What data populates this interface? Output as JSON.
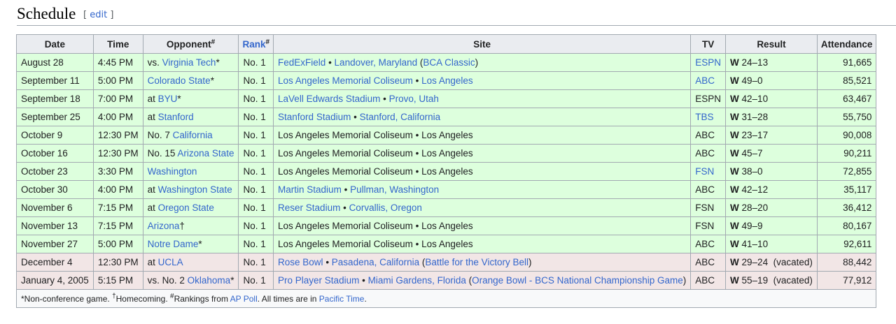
{
  "section": {
    "title": "Schedule",
    "edit_label": "edit"
  },
  "columns": {
    "date": "Date",
    "time": "Time",
    "opponent": "Opponent",
    "opponent_sup": "#",
    "rank": "Rank",
    "rank_sup": "#",
    "site": "Site",
    "tv": "TV",
    "result": "Result",
    "attendance": "Attendance"
  },
  "games": [
    {
      "status": "win",
      "date": "August 28",
      "time": "4:45 PM",
      "opp_prefix": "vs. ",
      "opp_name": "Virginia Tech",
      "opp_suffix": "*",
      "rank": "No. 1",
      "site": [
        {
          "t": "FedExField",
          "link": true
        },
        {
          "t": " • ",
          "link": false
        },
        {
          "t": "Landover, Maryland",
          "link": true
        },
        {
          "t": " (",
          "link": false
        },
        {
          "t": "BCA Classic",
          "link": true
        },
        {
          "t": ")",
          "link": false
        }
      ],
      "tv": "ESPN",
      "tv_link": true,
      "result_wl": "W",
      "result_score": " 24–13",
      "attendance": "91,665"
    },
    {
      "status": "win",
      "date": "September 11",
      "time": "5:00 PM",
      "opp_prefix": "",
      "opp_name": "Colorado State",
      "opp_suffix": "*",
      "rank": "No. 1",
      "site": [
        {
          "t": "Los Angeles Memorial Coliseum",
          "link": true
        },
        {
          "t": " • ",
          "link": false
        },
        {
          "t": "Los Angeles",
          "link": true
        }
      ],
      "tv": "ABC",
      "tv_link": true,
      "result_wl": "W",
      "result_score": " 49–0",
      "attendance": "85,521"
    },
    {
      "status": "win",
      "date": "September 18",
      "time": "7:00 PM",
      "opp_prefix": "at ",
      "opp_name": "BYU",
      "opp_suffix": "*",
      "rank": "No. 1",
      "site": [
        {
          "t": "LaVell Edwards Stadium",
          "link": true
        },
        {
          "t": " • ",
          "link": false
        },
        {
          "t": "Provo, Utah",
          "link": true
        }
      ],
      "tv": "ESPN",
      "tv_link": false,
      "result_wl": "W",
      "result_score": " 42–10",
      "attendance": "63,467"
    },
    {
      "status": "win",
      "date": "September 25",
      "time": "4:00 PM",
      "opp_prefix": "at ",
      "opp_name": "Stanford",
      "opp_suffix": "",
      "rank": "No. 1",
      "site": [
        {
          "t": "Stanford Stadium",
          "link": true
        },
        {
          "t": " • ",
          "link": false
        },
        {
          "t": "Stanford, California",
          "link": true
        }
      ],
      "tv": "TBS",
      "tv_link": true,
      "result_wl": "W",
      "result_score": " 31–28",
      "attendance": "55,750"
    },
    {
      "status": "win",
      "date": "October 9",
      "time": "12:30 PM",
      "opp_prefix": "No. 7 ",
      "opp_name": "California",
      "opp_suffix": "",
      "rank": "No. 1",
      "site": [
        {
          "t": "Los Angeles Memorial Coliseum • Los Angeles",
          "link": false
        }
      ],
      "tv": "ABC",
      "tv_link": false,
      "result_wl": "W",
      "result_score": " 23–17",
      "attendance": "90,008"
    },
    {
      "status": "win",
      "date": "October 16",
      "time": "12:30 PM",
      "opp_prefix": "No. 15 ",
      "opp_name": "Arizona State",
      "opp_suffix": "",
      "rank": "No. 1",
      "site": [
        {
          "t": "Los Angeles Memorial Coliseum • Los Angeles",
          "link": false
        }
      ],
      "tv": "ABC",
      "tv_link": false,
      "result_wl": "W",
      "result_score": " 45–7",
      "attendance": "90,211"
    },
    {
      "status": "win",
      "date": "October 23",
      "time": "3:30 PM",
      "opp_prefix": "",
      "opp_name": "Washington",
      "opp_suffix": "",
      "rank": "No. 1",
      "site": [
        {
          "t": "Los Angeles Memorial Coliseum • Los Angeles",
          "link": false
        }
      ],
      "tv": "FSN",
      "tv_link": true,
      "result_wl": "W",
      "result_score": " 38–0",
      "attendance": "72,855"
    },
    {
      "status": "win",
      "date": "October 30",
      "time": "4:00 PM",
      "opp_prefix": "at ",
      "opp_name": "Washington State",
      "opp_suffix": "",
      "rank": "No. 1",
      "site": [
        {
          "t": "Martin Stadium",
          "link": true
        },
        {
          "t": " • ",
          "link": false
        },
        {
          "t": "Pullman, Washington",
          "link": true
        }
      ],
      "tv": "ABC",
      "tv_link": false,
      "result_wl": "W",
      "result_score": " 42–12",
      "attendance": "35,117"
    },
    {
      "status": "win",
      "date": "November 6",
      "time": "7:15 PM",
      "opp_prefix": "at ",
      "opp_name": "Oregon State",
      "opp_suffix": "",
      "rank": "No. 1",
      "site": [
        {
          "t": "Reser Stadium",
          "link": true
        },
        {
          "t": " • ",
          "link": false
        },
        {
          "t": "Corvallis, Oregon",
          "link": true
        }
      ],
      "tv": "FSN",
      "tv_link": false,
      "result_wl": "W",
      "result_score": " 28–20",
      "attendance": "36,412"
    },
    {
      "status": "win",
      "date": "November 13",
      "time": "7:15 PM",
      "opp_prefix": "",
      "opp_name": "Arizona",
      "opp_suffix": "†",
      "rank": "No. 1",
      "site": [
        {
          "t": "Los Angeles Memorial Coliseum • Los Angeles",
          "link": false
        }
      ],
      "tv": "FSN",
      "tv_link": false,
      "result_wl": "W",
      "result_score": " 49–9",
      "attendance": "80,167"
    },
    {
      "status": "win",
      "date": "November 27",
      "time": "5:00 PM",
      "opp_prefix": "",
      "opp_name": "Notre Dame",
      "opp_suffix": "*",
      "rank": "No. 1",
      "site": [
        {
          "t": "Los Angeles Memorial Coliseum • Los Angeles",
          "link": false
        }
      ],
      "tv": "ABC",
      "tv_link": false,
      "result_wl": "W",
      "result_score": " 41–10",
      "attendance": "92,611"
    },
    {
      "status": "vacated",
      "date": "December 4",
      "time": "12:30 PM",
      "opp_prefix": "at ",
      "opp_name": "UCLA",
      "opp_suffix": "",
      "rank": "No. 1",
      "site": [
        {
          "t": "Rose Bowl",
          "link": true
        },
        {
          "t": " • ",
          "link": false
        },
        {
          "t": "Pasadena, California",
          "link": true
        },
        {
          "t": " (",
          "link": false
        },
        {
          "t": "Battle for the Victory Bell",
          "link": true
        },
        {
          "t": ")",
          "link": false
        }
      ],
      "tv": "ABC",
      "tv_link": false,
      "result_wl": "W",
      "result_score": " 29–24  (vacated)",
      "attendance": "88,442"
    },
    {
      "status": "vacated",
      "date": "January 4, 2005",
      "time": "5:15 PM",
      "opp_prefix": "vs. No. 2 ",
      "opp_name": "Oklahoma",
      "opp_suffix": "*",
      "rank": "No. 1",
      "site": [
        {
          "t": "Pro Player Stadium",
          "link": true
        },
        {
          "t": " • ",
          "link": false
        },
        {
          "t": "Miami Gardens, Florida",
          "link": true
        },
        {
          "t": " (",
          "link": false
        },
        {
          "t": "Orange Bowl - BCS National Championship Game",
          "link": true
        },
        {
          "t": ")",
          "link": false
        }
      ],
      "tv": "ABC",
      "tv_link": false,
      "result_wl": "W",
      "result_score": " 55–19  (vacated)",
      "attendance": "77,912"
    }
  ],
  "footnote": {
    "part1": "*Non-conference game. ",
    "dagger": "†",
    "part2": "Homecoming. ",
    "hash": "#",
    "part3": "Rankings from ",
    "poll_link": "AP Poll",
    "part4": ". All times are in ",
    "tz_link": "Pacific Time",
    "part5": "."
  },
  "colors": {
    "win_row": "#ddffdd",
    "vacated_row": "#f2e6e6",
    "link": "#3366cc",
    "header_bg": "#eaecf0",
    "border": "#a2a9b1"
  }
}
